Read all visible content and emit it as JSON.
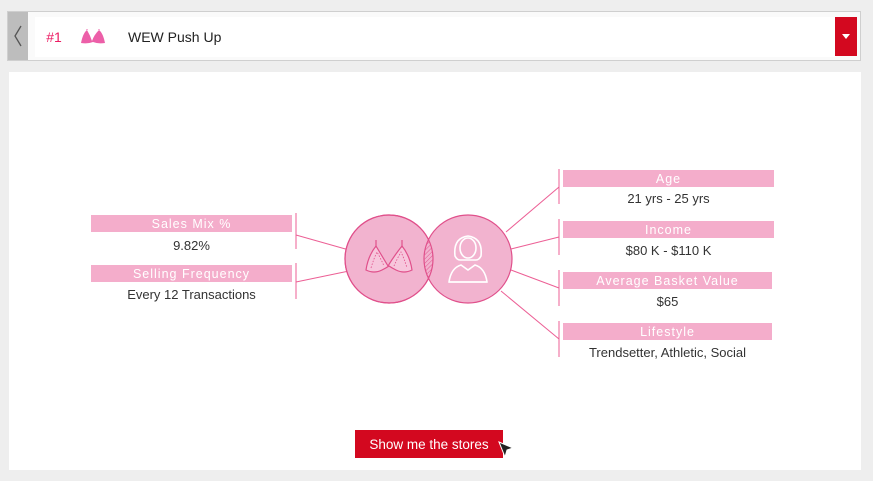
{
  "header": {
    "rank": "#1",
    "product_name": "WEW Push Up",
    "back_icon": "chevron-left-icon",
    "thumb_icon": "bra-icon",
    "dropdown_icon": "caret-down-icon"
  },
  "profile": {
    "left": [
      {
        "label": "Sales Mix %",
        "value": "9.82%"
      },
      {
        "label": "Selling Frequency",
        "value": "Every 12 Transactions"
      }
    ],
    "right": [
      {
        "label": "Age",
        "value": "21 yrs - 25 yrs"
      },
      {
        "label": "Income",
        "value": "$80 K - $110 K"
      },
      {
        "label": "Average Basket Value",
        "value": "$65"
      },
      {
        "label": "Lifestyle",
        "value": "Trendsetter, Athletic, Social"
      }
    ],
    "product_circle_icon": "bra-icon",
    "customer_circle_icon": "woman-avatar-icon"
  },
  "cta": {
    "label": "Show me the stores"
  },
  "colors": {
    "accent": "#d3081f",
    "pink": "#ec1c63",
    "light_pink": "#f4adcb",
    "circle_fill": "#f2b3cf"
  }
}
